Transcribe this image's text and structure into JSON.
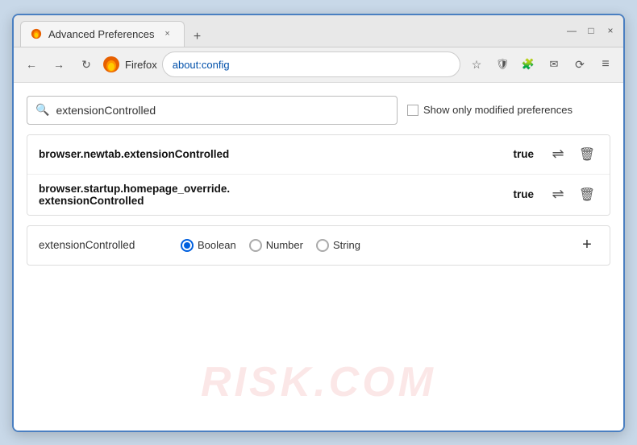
{
  "window": {
    "title": "Advanced Preferences",
    "tab_close": "×",
    "new_tab": "+",
    "win_minimize": "—",
    "win_maximize": "□",
    "win_close": "×"
  },
  "navbar": {
    "back": "←",
    "forward": "→",
    "reload": "↻",
    "browser_name": "Firefox",
    "address": "about:config",
    "bookmark_icon": "☆",
    "shield_icon": "🛡",
    "extension_icon": "🧩",
    "profile_icon": "✉",
    "sync_icon": "⟳",
    "menu_icon": "≡"
  },
  "search": {
    "placeholder": "extensionControlled",
    "value": "extensionControlled",
    "show_modified_label": "Show only modified preferences"
  },
  "preferences": [
    {
      "name": "browser.newtab.extensionControlled",
      "value": "true"
    },
    {
      "name1": "browser.startup.homepage_override.",
      "name2": "extensionControlled",
      "value": "true"
    }
  ],
  "new_pref": {
    "name": "extensionControlled",
    "types": [
      "Boolean",
      "Number",
      "String"
    ],
    "selected_type": "Boolean"
  },
  "watermark": "RISK.COM",
  "icons": {
    "search": "🔍",
    "exchange": "⇌",
    "delete": "🗑",
    "add": "+"
  }
}
